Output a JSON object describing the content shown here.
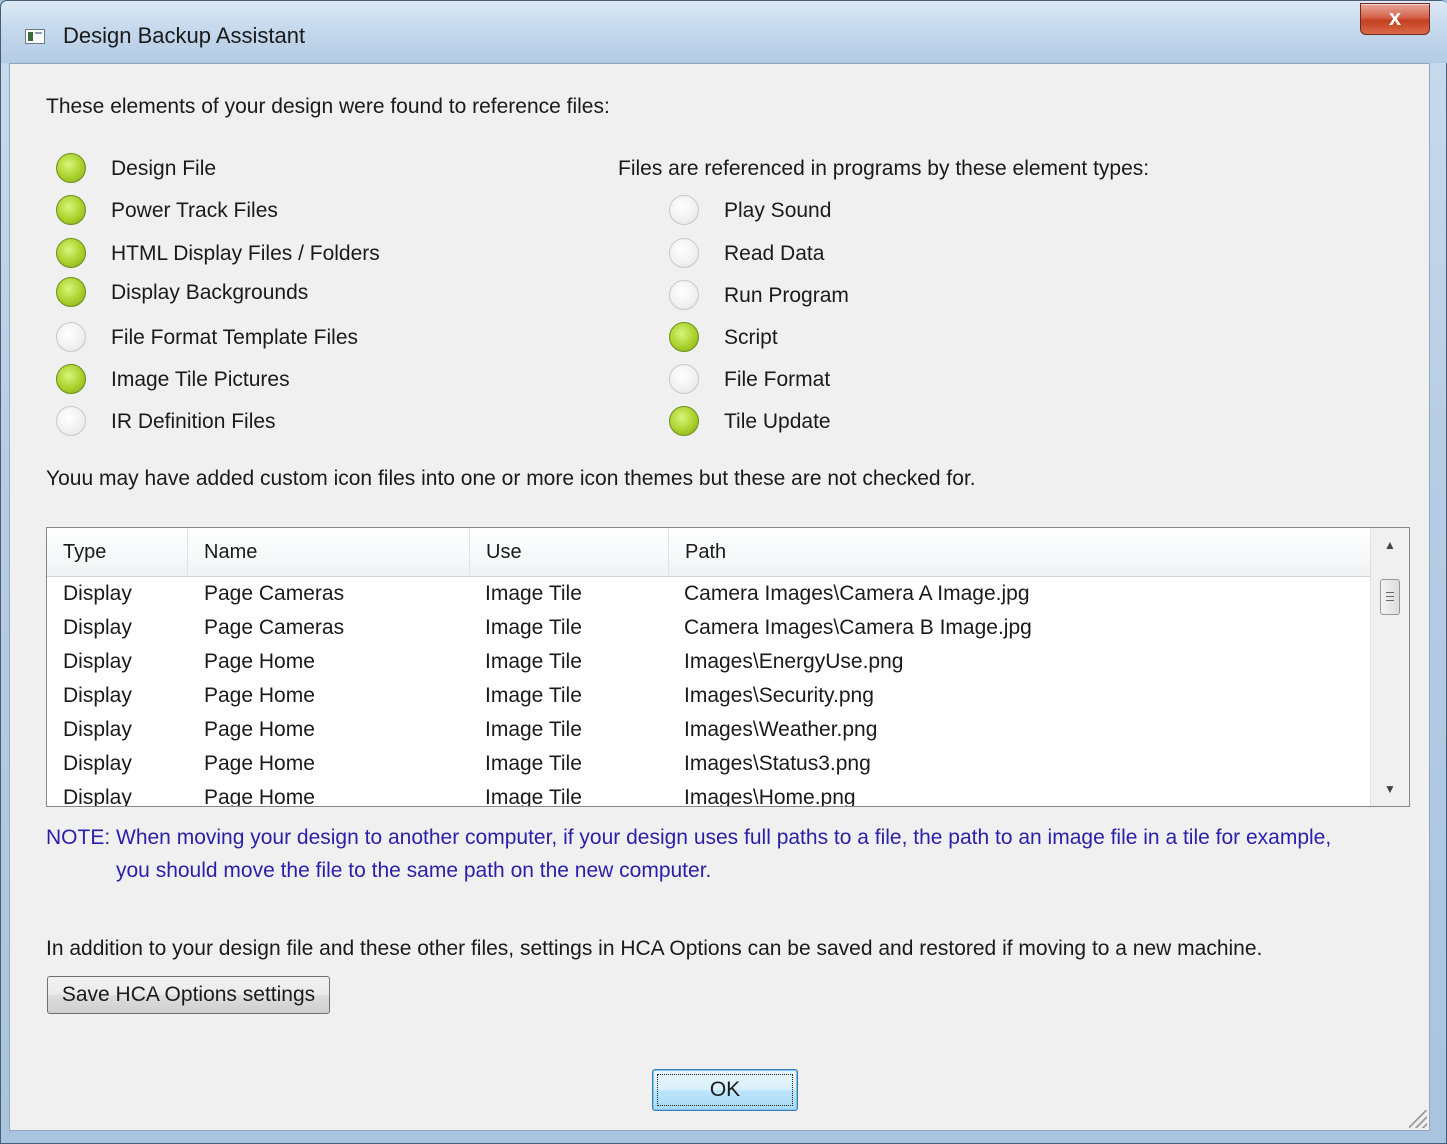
{
  "window": {
    "title": "Design Backup Assistant",
    "close_glyph": "x"
  },
  "intro": "These elements of your design were found to reference files:",
  "left_items": [
    {
      "label": "Design File",
      "state": "on"
    },
    {
      "label": "Power Track Files",
      "state": "on"
    },
    {
      "label": "HTML Display Files / Folders",
      "state": "on"
    },
    {
      "label": "Display Backgrounds",
      "state": "on"
    },
    {
      "label": "File Format Template Files",
      "state": "off"
    },
    {
      "label": "Image Tile Pictures",
      "state": "on"
    },
    {
      "label": "IR Definition Files",
      "state": "off"
    }
  ],
  "right_heading": "Files are referenced in programs by these element types:",
  "right_items": [
    {
      "label": "Play Sound",
      "state": "off"
    },
    {
      "label": "Read Data",
      "state": "off"
    },
    {
      "label": "Run Program",
      "state": "off"
    },
    {
      "label": "Script",
      "state": "on"
    },
    {
      "label": "File Format",
      "state": "off"
    },
    {
      "label": "Tile Update",
      "state": "on"
    }
  ],
  "icon_note": "Youu may have added custom icon files into one or more icon themes but these are not checked for.",
  "table": {
    "columns": [
      "Type",
      "Name",
      "Use",
      "Path"
    ],
    "rows": [
      [
        "Display",
        "Page Cameras",
        "Image Tile",
        "Camera Images\\Camera A Image.jpg"
      ],
      [
        "Display",
        "Page Cameras",
        "Image Tile",
        "Camera Images\\Camera B Image.jpg"
      ],
      [
        "Display",
        "Page Home",
        "Image Tile",
        "Images\\EnergyUse.png"
      ],
      [
        "Display",
        "Page Home",
        "Image Tile",
        "Images\\Security.png"
      ],
      [
        "Display",
        "Page Home",
        "Image Tile",
        "Images\\Weather.png"
      ],
      [
        "Display",
        "Page Home",
        "Image Tile",
        "Images\\Status3.png"
      ],
      [
        "Display",
        "Page Home",
        "Image Tile",
        "Images\\Home.png"
      ]
    ]
  },
  "note_line1": "NOTE: When moving your design to another computer, if your design uses full paths to a file, the path to an image file in a tile for example,",
  "note_line2": "you should move the file to the same path on the new computer.",
  "options_text": "In addition to your design file and these other files, settings in HCA Options can be saved and restored if moving to a new machine.",
  "buttons": {
    "save_options": "Save HCA Options settings",
    "ok": "OK"
  },
  "colors": {
    "indicator_on": "#a9d12c",
    "indicator_off": "#f0f0f0",
    "note_text": "#2a1fa8"
  }
}
